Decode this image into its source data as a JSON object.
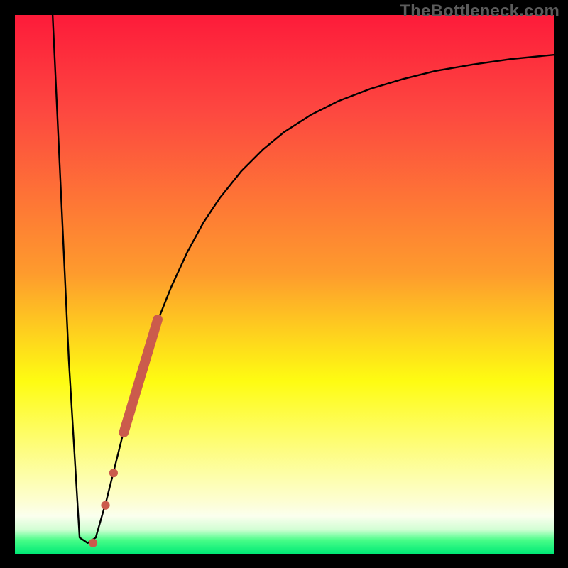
{
  "watermark": {
    "text": "TheBottleneck.com"
  },
  "colors": {
    "top": "#fd1b3a",
    "mid_red": "#fd4840",
    "orange": "#fe9b2d",
    "yellow": "#fefc12",
    "pale_yellow": "#fdfed0",
    "cream": "#fbffee",
    "mint": "#d2fed4",
    "green_lt": "#48fd88",
    "green": "#00e976",
    "black": "#000000",
    "marker": "#cb5b4c"
  },
  "chart_data": {
    "type": "line",
    "title": "",
    "xlabel": "",
    "ylabel": "",
    "xlim": [
      0,
      100
    ],
    "ylim": [
      0,
      100
    ],
    "grid": false,
    "series": [
      {
        "name": "bottleneck-curve",
        "x": [
          7.0,
          10.0,
          12.0,
          13.5,
          15.0,
          17.0,
          19.0,
          21.0,
          23.5,
          26.0,
          29.0,
          32.0,
          35.0,
          38.0,
          42.0,
          46.0,
          50.0,
          55.0,
          60.0,
          66.0,
          72.0,
          78.0,
          85.0,
          92.0,
          100.0
        ],
        "y": [
          100.0,
          36.0,
          3.0,
          2.0,
          3.0,
          10.0,
          18.0,
          26.0,
          34.5,
          42.0,
          49.5,
          56.0,
          61.5,
          66.0,
          71.0,
          75.0,
          78.3,
          81.5,
          84.0,
          86.3,
          88.1,
          89.6,
          90.8,
          91.8,
          92.6
        ]
      }
    ],
    "markers": [
      {
        "name": "marker-dot-1",
        "x": 14.5,
        "y": 2.0,
        "r": 0.8
      },
      {
        "name": "marker-dot-2",
        "x": 16.8,
        "y": 9.0,
        "r": 0.8
      },
      {
        "name": "marker-dot-3",
        "x": 18.3,
        "y": 15.0,
        "r": 0.8
      },
      {
        "name": "marker-bar",
        "type": "segment",
        "x1": 20.2,
        "y1": 22.5,
        "x2": 26.5,
        "y2": 43.5,
        "width": 1.8
      }
    ]
  }
}
